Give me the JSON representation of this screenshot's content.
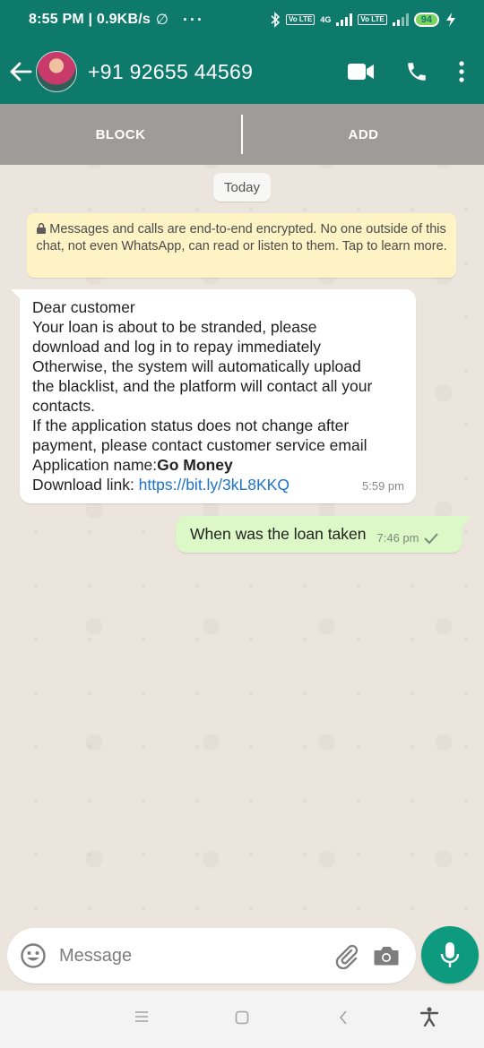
{
  "status_bar": {
    "time": "8:55 PM",
    "speed": "0.9KB/s",
    "battery": "94",
    "net_4g": "4G",
    "volte_1": "Vo LTE",
    "volte_2": "Vo LTE"
  },
  "header": {
    "contact": "+91 92655 44569",
    "color": "#0e7a6b"
  },
  "actions": {
    "block_label": "BLOCK",
    "add_label": "ADD"
  },
  "chat": {
    "date_chip": "Today",
    "encryption_notice": "Messages and calls are end-to-end encrypted. No one outside of this chat, not even WhatsApp, can read or listen to them. Tap to learn more.",
    "incoming": {
      "lines": [
        "Dear customer",
        "Your loan is about to be stranded, please",
        "download and log in to repay immediately",
        "Otherwise, the system will automatically upload",
        "the blacklist, and the platform will contact all your",
        "contacts.",
        "If the application status does not change after",
        "payment, please contact customer service email"
      ],
      "app_name_prefix": "Application name:",
      "app_name": "Go Money",
      "download_prefix": "Download link: ",
      "download_link": "https://bit.ly/3kL8KKQ",
      "time": "5:59 pm"
    },
    "outgoing": {
      "text": "When was the loan taken",
      "time": "7:46 pm",
      "status_icon": "single-check-icon"
    }
  },
  "composer": {
    "placeholder": "Message",
    "accent": "#0e9a7f"
  }
}
